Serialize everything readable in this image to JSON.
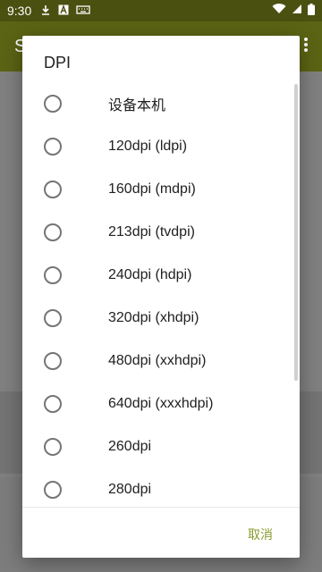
{
  "status_bar": {
    "time": "9:30",
    "icons": [
      "download-icon",
      "a-icon",
      "keyboard-icon"
    ],
    "right_icons": [
      "wifi-icon",
      "signal-icon",
      "battery-icon"
    ]
  },
  "app_bar": {
    "title_initial": "S"
  },
  "dialog": {
    "title": "DPI",
    "options": [
      {
        "label": "设备本机",
        "selected": false
      },
      {
        "label": "120dpi (ldpi)",
        "selected": false
      },
      {
        "label": "160dpi (mdpi)",
        "selected": false
      },
      {
        "label": "213dpi (tvdpi)",
        "selected": false
      },
      {
        "label": "240dpi (hdpi)",
        "selected": false
      },
      {
        "label": "320dpi (xhdpi)",
        "selected": false
      },
      {
        "label": "480dpi (xxhdpi)",
        "selected": false
      },
      {
        "label": "640dpi (xxxhdpi)",
        "selected": false
      },
      {
        "label": "260dpi",
        "selected": false
      },
      {
        "label": "280dpi",
        "selected": false
      }
    ],
    "cancel_label": "取消",
    "accent_color": "#8a9a2b"
  }
}
